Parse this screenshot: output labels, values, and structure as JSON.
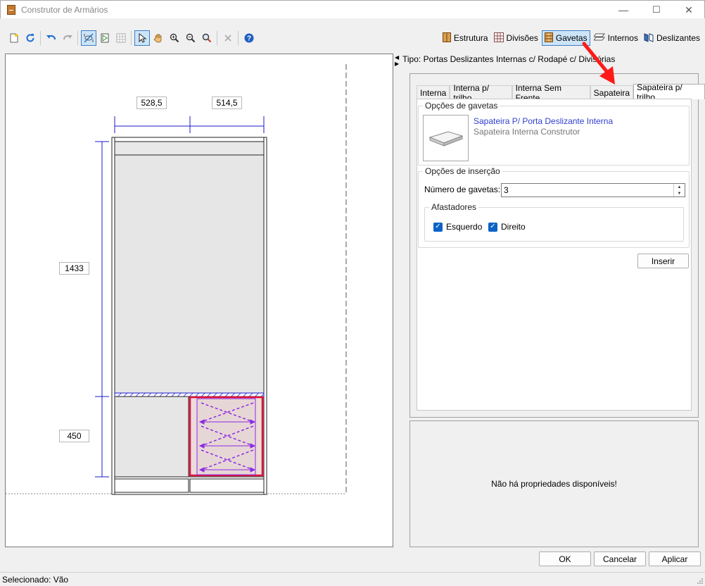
{
  "window": {
    "title": "Construtor de Armários",
    "minimize": "—",
    "maximize": "☐",
    "close": "✕"
  },
  "toolbar": {
    "tabs": [
      {
        "label": "Estrutura",
        "icon": "cabinet-icon",
        "active": false
      },
      {
        "label": "Divisões",
        "icon": "grid-icon",
        "active": false
      },
      {
        "label": "Gavetas",
        "icon": "drawer-icon",
        "active": true
      },
      {
        "label": "Internos",
        "icon": "shelves-icon",
        "active": false
      },
      {
        "label": "Deslizantes",
        "icon": "sliding-door-icon",
        "active": false
      }
    ]
  },
  "drawing": {
    "top_dims": [
      "528,5",
      "514,5"
    ],
    "left_dims": [
      "1433",
      "450"
    ]
  },
  "header": {
    "tipo": "Tipo: Portas Deslizantes Internas c/ Rodapé c/ Divisórias"
  },
  "tabs": [
    "Interna",
    "Interna p/ trilho",
    "Interna Sem Frente",
    "Sapateira",
    "Sapateira p/ trilho"
  ],
  "active_tab": "Sapateira p/ trilho",
  "drawer_options": {
    "legend": "Opções de gavetas",
    "item_title": "Sapateira P/ Porta Deslizante Interna",
    "item_subtitle": "Sapateira Interna Construtor"
  },
  "insert_options": {
    "legend": "Opções de inserção",
    "count_label": "Número de gavetas:",
    "count_value": "3",
    "spacers_legend": "Afastadores",
    "left_label": "Esquerdo",
    "left_checked": true,
    "right_label": "Direito",
    "right_checked": true,
    "insert_button": "Inserir"
  },
  "properties": {
    "empty_text": "Não há propriedades disponíveis!"
  },
  "footer": {
    "ok": "OK",
    "cancel": "Cancelar",
    "apply": "Aplicar"
  },
  "status": {
    "text": "Selecionado: Vão"
  },
  "colors": {
    "accent": "#3f7fc6",
    "link_blue": "#2f3fd0",
    "highlight_red": "#e0103a",
    "drawer_purple": "#8a2be2",
    "annotation_arrow": "#ff1a1a"
  }
}
